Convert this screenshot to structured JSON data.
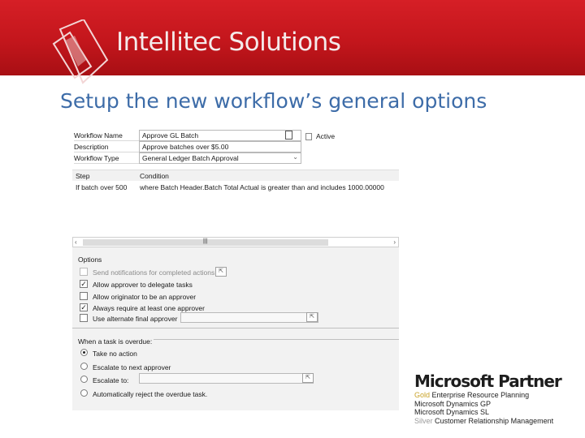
{
  "header": {
    "brand": "Intellitec Solutions",
    "colors": {
      "bar": "#c3161c",
      "logo": "white-diamond-outline"
    }
  },
  "slide": {
    "title": "Setup the new workflow’s general options"
  },
  "workflow_form": {
    "fields": [
      {
        "label": "Workflow Name",
        "value": "Approve GL Batch"
      },
      {
        "label": "Description",
        "value": "Approve batches over $5.00"
      },
      {
        "label": "Workflow Type",
        "value": "General Ledger Batch Approval"
      }
    ],
    "active_label": "Active",
    "active_checked": false,
    "step_table": {
      "headers": [
        "Step",
        "Condition"
      ],
      "rows": [
        [
          "If batch over 500",
          "where Batch Header.Batch Total Actual is greater than and includes 1000.00000"
        ]
      ]
    }
  },
  "options": {
    "section_label": "Options",
    "checkboxes": [
      {
        "label": "Send notifications for completed actions",
        "checked": false,
        "enabled": false
      },
      {
        "label": "Allow approver to delegate tasks",
        "checked": true,
        "enabled": true
      },
      {
        "label": "Allow originator to be an approver",
        "checked": false,
        "enabled": true
      },
      {
        "label": "Always require at least one approver",
        "checked": true,
        "enabled": true
      },
      {
        "label": "Use alternate final approver",
        "checked": false,
        "enabled": true
      }
    ],
    "overdue_label": "When a task is overdue:",
    "radios": [
      {
        "label": "Take no action",
        "selected": true
      },
      {
        "label": "Escalate to next approver",
        "selected": false
      },
      {
        "label": "Escalate to:",
        "selected": false
      },
      {
        "label": "Automatically reject the overdue task.",
        "selected": false
      }
    ]
  },
  "partner": {
    "title": "Microsoft Partner",
    "lines": [
      {
        "tier": "Gold",
        "text": "Enterprise Resource Planning"
      },
      {
        "tier": "",
        "text": "Microsoft Dynamics GP"
      },
      {
        "tier": "",
        "text": "Microsoft Dynamics SL"
      },
      {
        "tier": "Silver",
        "text": "Customer Relationship Management"
      }
    ]
  }
}
